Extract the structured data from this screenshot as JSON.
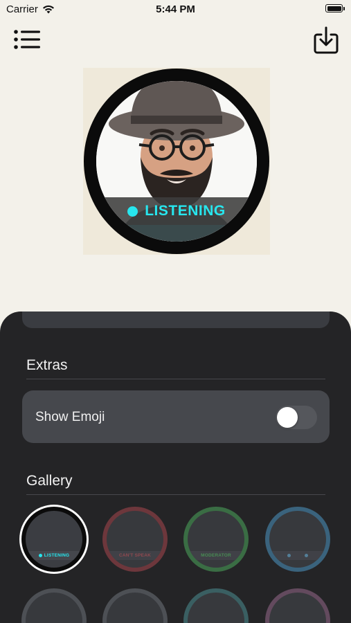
{
  "status_bar": {
    "carrier": "Carrier",
    "time": "5:44 PM",
    "icons": [
      "wifi-icon",
      "battery-icon"
    ]
  },
  "nav": {
    "menu_icon": "list-icon",
    "export_icon": "download-to-tray-icon"
  },
  "preview": {
    "status_label": "LISTENING",
    "status_color": "#27e6ee",
    "ring_color": "#0b0b0b"
  },
  "sheet": {
    "extras_title": "Extras",
    "show_emoji_label": "Show Emoji",
    "show_emoji_on": false,
    "gallery_title": "Gallery",
    "gallery": [
      {
        "label": "LISTENING",
        "ring": "#0b0b0b",
        "text_color": "#27e6ee",
        "dots": 1,
        "selected": true
      },
      {
        "label": "CAN'T SPEAK",
        "ring": "#7a3b40",
        "text_color": "#a45058",
        "dots": 0,
        "selected": false
      },
      {
        "label": "MODERATOR",
        "ring": "#3f7a4a",
        "text_color": "#4f9e5c",
        "dots": 0,
        "selected": false
      },
      {
        "label": "",
        "ring": "#3f6f8d",
        "text_color": "#5d8fad",
        "dots": 2,
        "selected": false
      },
      {
        "label": "",
        "ring": "#55585e",
        "text_color": "#777777",
        "dots": 0,
        "selected": false
      },
      {
        "label": "",
        "ring": "#55585e",
        "text_color": "#777777",
        "dots": 0,
        "selected": false
      },
      {
        "label": "",
        "ring": "#3e6a6d",
        "text_color": "#777777",
        "dots": 0,
        "selected": false
      },
      {
        "label": "",
        "ring": "#6e5168",
        "text_color": "#777777",
        "dots": 0,
        "selected": false
      }
    ]
  }
}
